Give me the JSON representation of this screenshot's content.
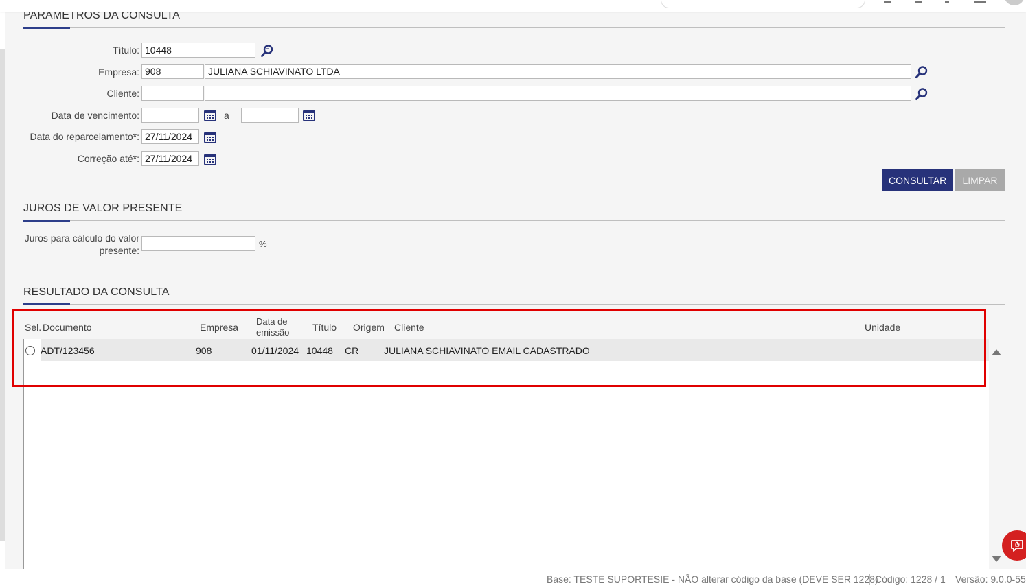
{
  "params": {
    "title": "PARÂMETROS DA CONSULTA",
    "titulo_label": "Título:",
    "titulo_value": "10448",
    "empresa_label": "Empresa:",
    "empresa_code": "908",
    "empresa_name": "JULIANA SCHIAVINATO LTDA",
    "cliente_label": "Cliente:",
    "cliente_code": "",
    "cliente_name": "",
    "vencimento_label": "Data de vencimento:",
    "vencimento_from": "",
    "vencimento_sep": "a",
    "vencimento_to": "",
    "reparcelamento_label": "Data do reparcelamento*:",
    "reparcelamento_value": "27/11/2024",
    "correcao_label": "Correção até*:",
    "correcao_value": "27/11/2024",
    "consultar_label": "CONSULTAR",
    "limpar_label": "LIMPAR"
  },
  "juros": {
    "title": "JUROS DE VALOR PRESENTE",
    "label_line1": "Juros para cálculo do valor",
    "label_line2": "presente:",
    "value": "",
    "unit": "%"
  },
  "result": {
    "title": "RESULTADO DA CONSULTA",
    "headers": {
      "sel": "Sel.",
      "documento": "Documento",
      "empresa": "Empresa",
      "data_l1": "Data de",
      "data_l2": "emissão",
      "titulo": "Título",
      "origem": "Origem",
      "cliente": "Cliente",
      "unidade": "Unidade"
    },
    "rows": [
      {
        "documento": "ADT/123456",
        "empresa": "908",
        "data_emissao": "01/11/2024",
        "titulo": "10448",
        "origem": "CR",
        "cliente": "JULIANA SCHIAVINATO EMAIL CADASTRADO",
        "unidade": ""
      }
    ]
  },
  "status": {
    "base": "Base: TESTE SUPORTESIE - NÃO alterar código da base (DEVE SER 1228)",
    "codigo": "Código: 1228 / 1",
    "versao": "Versão: 9.0.0-55"
  },
  "colors": {
    "primary": "#27327a",
    "highlight": "#e00000",
    "chat": "#d42020"
  }
}
